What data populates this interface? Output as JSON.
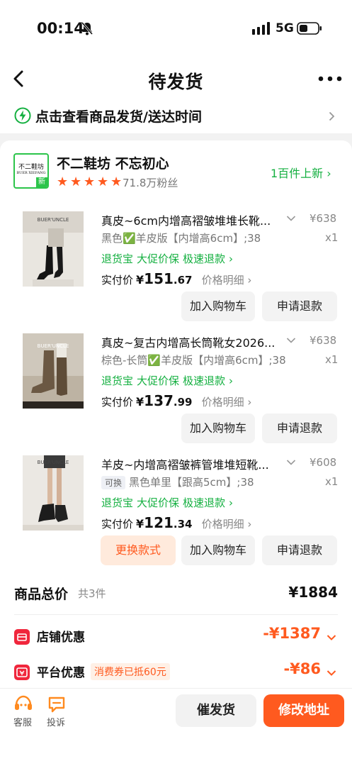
{
  "status": {
    "time": "00:14",
    "network": "5G"
  },
  "nav": {
    "title": "待发货"
  },
  "shipping": {
    "text": "点击查看商品发货/送达时间"
  },
  "shop": {
    "logo_line1": "不二鞋坊",
    "logo_line2": "BUER XIEFANG",
    "logo_badge": "新",
    "name": "不二鞋坊 不忘初心",
    "rating_stars": 5,
    "fans": "71.8万粉丝",
    "new_items": "1百件上新"
  },
  "items": [
    {
      "title": "真皮~6cm内增高褶皱堆堆长靴...",
      "list_price": "¥638",
      "variant": "黑色✅羊皮版【内增高6cm】;38",
      "qty": "x1",
      "services": [
        "退货宝",
        "大促价保",
        "极速退款"
      ],
      "paid_label": "实付价",
      "paid_symbol": "¥",
      "paid_int": "151",
      "paid_dec": ".67",
      "price_detail": "价格明细",
      "thumb_brand": "BUER'UNCLE",
      "btn_cart": "加入购物车",
      "btn_refund": "申请退款"
    },
    {
      "title": "真皮~复古内增高长筒靴女2026...",
      "list_price": "¥638",
      "variant": "棕色-长筒✅羊皮版【内增高6cm】;38",
      "qty": "x1",
      "services": [
        "退货宝",
        "大促价保",
        "极速退款"
      ],
      "paid_label": "实付价",
      "paid_symbol": "¥",
      "paid_int": "137",
      "paid_dec": ".99",
      "price_detail": "价格明细",
      "thumb_brand": "BUER'UNCLE",
      "btn_cart": "加入购物车",
      "btn_refund": "申请退款"
    },
    {
      "title": "羊皮~内增高褶皱裤管堆堆短靴...",
      "list_price": "¥608",
      "exchange_tag": "可换",
      "variant": "黑色单里【跟高5cm】;38",
      "qty": "x1",
      "services": [
        "退货宝",
        "大促价保",
        "极速退款"
      ],
      "paid_label": "实付价",
      "paid_symbol": "¥",
      "paid_int": "121",
      "paid_dec": ".34",
      "price_detail": "价格明细",
      "thumb_brand": "BUER'UNCLE",
      "btn_exchange": "更换款式",
      "btn_cart": "加入购物车",
      "btn_refund": "申请退款"
    }
  ],
  "summary": {
    "total_label": "商品总价",
    "total_count": "共3件",
    "total_value": "¥1884",
    "shop_discount_label": "店铺优惠",
    "shop_discount_value": "-¥1387",
    "platform_discount_label": "平台优惠",
    "platform_coupon_tag": "消费券已抵60元",
    "platform_discount_value": "-¥86"
  },
  "bottom": {
    "service_label": "客服",
    "complaint_label": "投诉",
    "remind_btn": "催发货",
    "modify_btn": "修改地址"
  },
  "colors": {
    "accent": "#ff5a1f",
    "green": "#15b041",
    "discount_red": "#f0263c"
  }
}
